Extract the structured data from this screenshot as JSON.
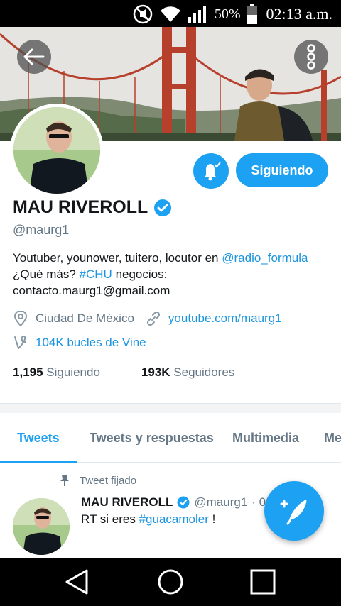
{
  "status_bar": {
    "battery": "50%",
    "time": "02:13 a.m.",
    "icons": [
      "mute-icon",
      "wifi-icon",
      "signal-icon",
      "battery-icon"
    ]
  },
  "header": {
    "back_icon": "back-arrow-icon",
    "more_icon": "more-vertical-icon"
  },
  "profile": {
    "name": "MAU RIVEROLL",
    "handle": "@maurg1",
    "verified": true,
    "follow_button": "Siguiendo",
    "bio": {
      "line1_text": "Youtuber, younower, tuitero, locutor en ",
      "line1_mention": "@radio_formula",
      "line2_prefix": "¿Qué más? ",
      "line2_hashtag": "#CHU",
      "line2_suffix": " negocios:",
      "line3": "contacto.maurg1@gmail.com"
    },
    "location": "Ciudad De México",
    "website": "youtube.com/maurg1",
    "vine": "104K bucles de Vine",
    "following_count": "1,195",
    "following_label": "Siguiendo",
    "followers_count": "193K",
    "followers_label": "Seguidores"
  },
  "tabs": [
    "Tweets",
    "Tweets y respuestas",
    "Multimedia",
    "Me"
  ],
  "active_tab": 0,
  "pinned_tweet": {
    "pinned_label": "Tweet fijado",
    "name": "MAU RIVEROLL",
    "handle": "@maurg1",
    "time": "· 02 a",
    "text_prefix": "RT si eres ",
    "hashtag": "#guacamoler",
    "text_suffix": " !"
  },
  "colors": {
    "accent": "#1da1f2",
    "link": "#1b95e0",
    "muted": "#657786"
  }
}
